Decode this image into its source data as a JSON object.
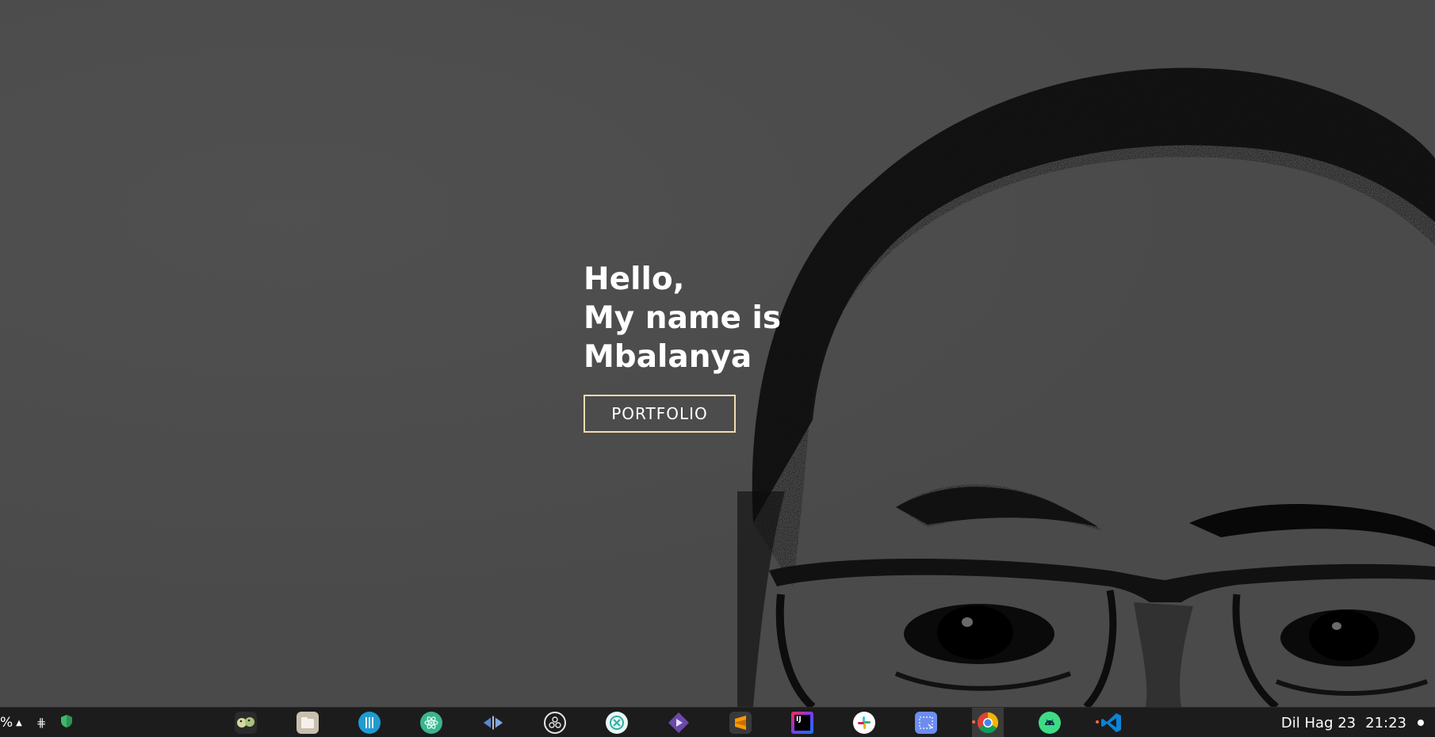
{
  "hero": {
    "greeting_lines": [
      "Hello,",
      "My name is",
      "Mbalanya"
    ],
    "button_label": "PORTFOLIO",
    "button_border_color": "#f1dcb1",
    "background_color": "#4a4a4a"
  },
  "taskbar": {
    "battery_text": "%",
    "tray_icons": [
      "expand-tray-icon",
      "slack-tray-icon",
      "shield-icon"
    ],
    "apps": [
      {
        "name": "pidgin-icon",
        "color": "#2b2b2b"
      },
      {
        "name": "files-icon",
        "color": "#c9bfae"
      },
      {
        "name": "tilix-icon",
        "color": "#1f9bd1"
      },
      {
        "name": "atom-icon",
        "color": "#3db38f"
      },
      {
        "name": "meld-icon",
        "color": "#5b86c9"
      },
      {
        "name": "obs-icon",
        "color": "#1c1c1c"
      },
      {
        "name": "remmina-icon",
        "color": "#2fb0a3"
      },
      {
        "name": "kdenlive-icon",
        "color": "#6b4aa8"
      },
      {
        "name": "sublime-text-icon",
        "color": "#3a3a3a"
      },
      {
        "name": "intellij-icon",
        "color": "#1a1a1a"
      },
      {
        "name": "slack-icon",
        "color": "#ffffff"
      },
      {
        "name": "screenshot-icon",
        "color": "#6d8df0"
      },
      {
        "name": "chrome-icon",
        "color": "#ffffff"
      },
      {
        "name": "android-studio-icon",
        "color": "#3ddc84"
      },
      {
        "name": "vscode-icon",
        "color": "#0a84d8"
      }
    ],
    "date_text": "Dil Hag 23",
    "time_text": "21:23"
  }
}
